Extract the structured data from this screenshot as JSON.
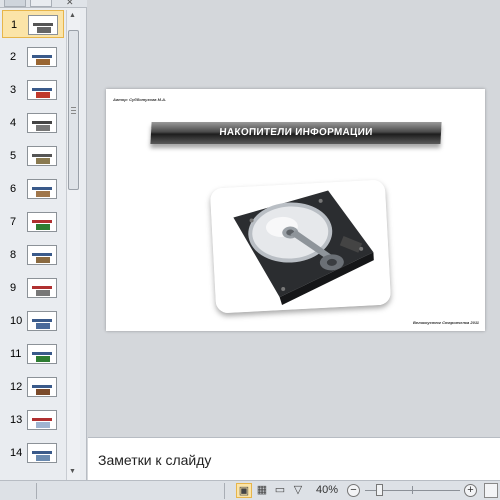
{
  "thumbnails": [
    {
      "num": "1",
      "bar": "#555555",
      "block": "#666666",
      "selected": true
    },
    {
      "num": "2",
      "bar": "#3a5a8a",
      "block": "#996633"
    },
    {
      "num": "3",
      "bar": "#3a5a8a",
      "block": "#c0392b"
    },
    {
      "num": "4",
      "bar": "#444444",
      "block": "#777777"
    },
    {
      "num": "5",
      "bar": "#555555",
      "block": "#8a7a50"
    },
    {
      "num": "6",
      "bar": "#3a5a8a",
      "block": "#a0764a"
    },
    {
      "num": "7",
      "bar": "#b03030",
      "block": "#2e7d32"
    },
    {
      "num": "8",
      "bar": "#3a5a8a",
      "block": "#8a6a40"
    },
    {
      "num": "9",
      "bar": "#b03030",
      "block": "#777777"
    },
    {
      "num": "10",
      "bar": "#3a5a8a",
      "block": "#4a6a9a"
    },
    {
      "num": "11",
      "bar": "#3a5a8a",
      "block": "#2e7d32"
    },
    {
      "num": "12",
      "bar": "#3a5a8a",
      "block": "#7a4a2a"
    },
    {
      "num": "13",
      "bar": "#b03030",
      "block": "#9fb4d0"
    },
    {
      "num": "14",
      "bar": "#3a5a8a",
      "block": "#6a8ab0"
    }
  ],
  "slide": {
    "author": "Автор: Субботухова М.А.",
    "title": "НАКОПИТЕЛИ ИНФОРМАЦИИ",
    "image": "hard-disk-drive-photo",
    "footer": "Великоустюг Старовчелка 2011"
  },
  "notes": {
    "placeholder": "Заметки к слайду"
  },
  "statusbar": {
    "zoom": "40%",
    "zoom_minus": "−",
    "zoom_plus": "+",
    "zoom_level_percent": 40
  },
  "colors": {
    "selection": "#fbe4a8",
    "selection_border": "#e7b54a",
    "pane_bg": "#e9ecf0",
    "workspace_bg": "#d4d7db"
  }
}
